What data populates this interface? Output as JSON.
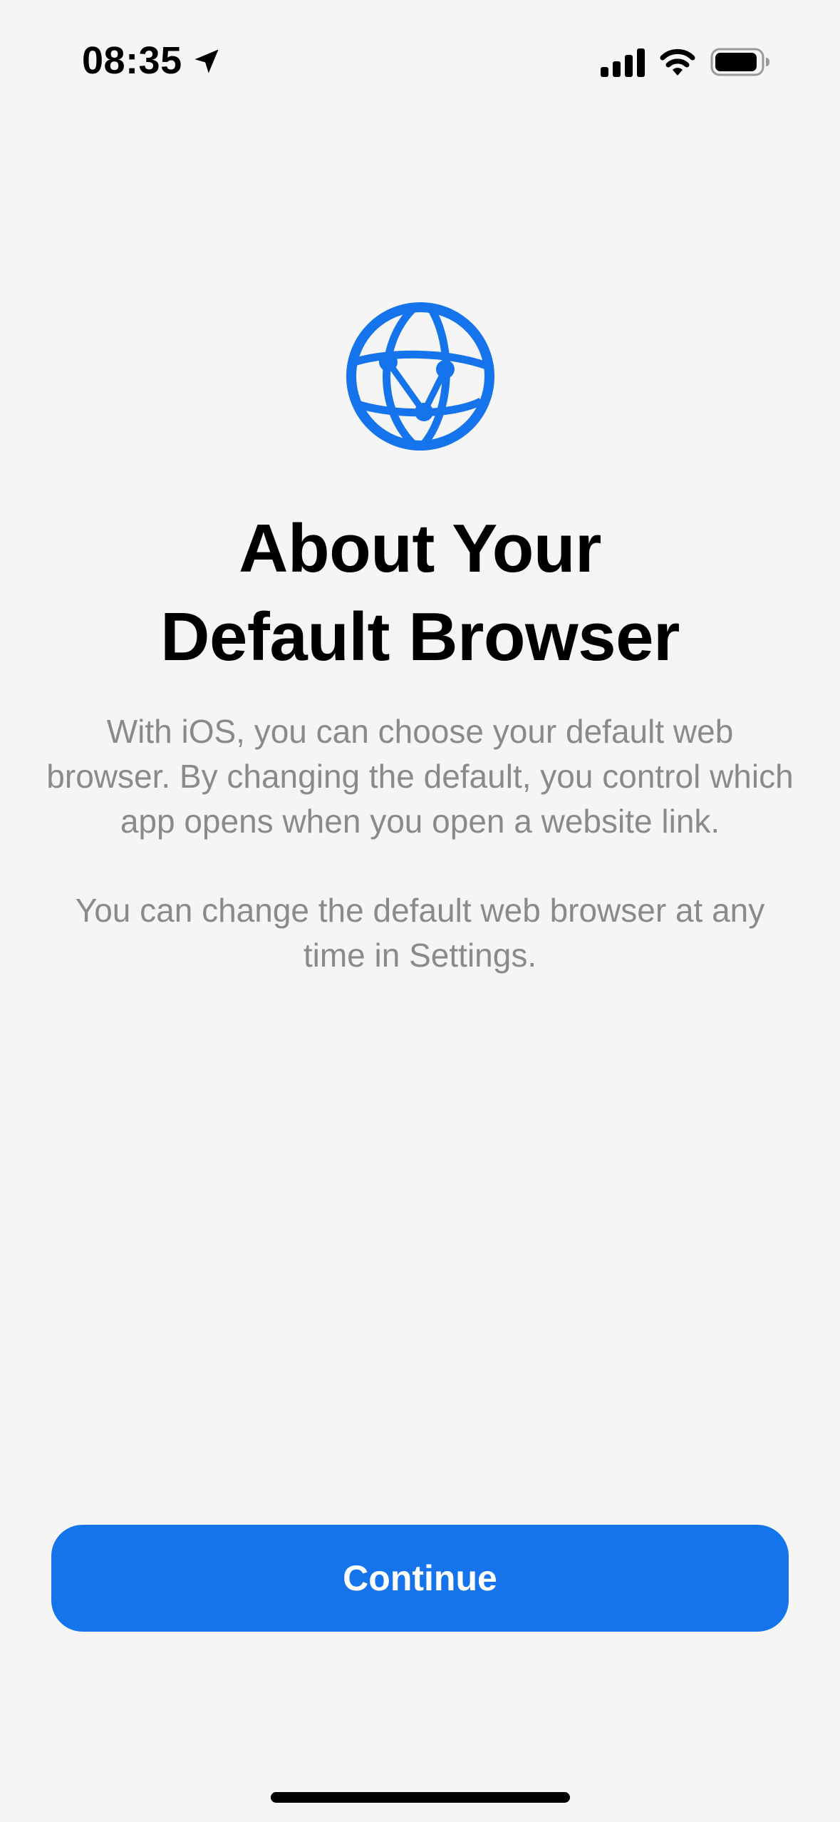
{
  "status_bar": {
    "time": "08:35",
    "icons": [
      "location-arrow-icon",
      "cellular-signal-icon",
      "wifi-icon",
      "battery-icon"
    ]
  },
  "main": {
    "icon": "globe-icon",
    "title": "About Your\nDefault Browser",
    "paragraphs": [
      "With iOS, you can choose your default web browser. By changing the default, you control which app opens when you open a website link.",
      "You can change the default web browser at any time in Settings."
    ]
  },
  "footer": {
    "continue_label": "Continue"
  },
  "colors": {
    "accent": "#1574ec",
    "background": "#f5f5f5",
    "body_text": "#8a8a8e",
    "title_text": "#000000"
  }
}
